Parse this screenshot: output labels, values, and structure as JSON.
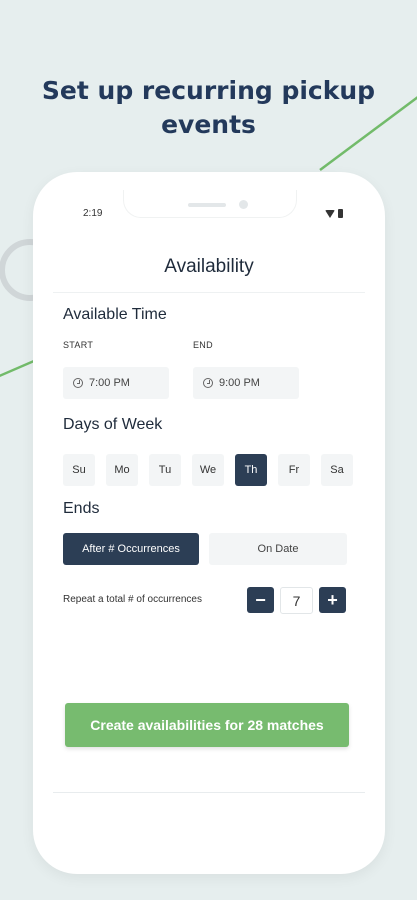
{
  "promo": {
    "headline_line1": "Set up recurring pickup",
    "headline_line2": "events"
  },
  "status_bar": {
    "time": "2:19"
  },
  "screen": {
    "title": "Availability"
  },
  "available_time": {
    "heading": "Available Time",
    "start": {
      "label": "START",
      "value": "7:00 PM"
    },
    "end": {
      "label": "END",
      "value": "9:00 PM"
    }
  },
  "days_of_week": {
    "heading": "Days of Week",
    "days": [
      {
        "label": "Su",
        "selected": false
      },
      {
        "label": "Mo",
        "selected": false
      },
      {
        "label": "Tu",
        "selected": false
      },
      {
        "label": "We",
        "selected": false
      },
      {
        "label": "Th",
        "selected": true
      },
      {
        "label": "Fr",
        "selected": false
      },
      {
        "label": "Sa",
        "selected": false
      }
    ]
  },
  "ends": {
    "heading": "Ends",
    "options": [
      {
        "label": "After # Occurrences",
        "selected": true
      },
      {
        "label": "On Date",
        "selected": false
      }
    ],
    "repeat_label": "Repeat a total # of occurrences",
    "decrement_symbol": "−",
    "count": "7",
    "increment_symbol": "+"
  },
  "cta": {
    "label": "Create availabilities for 28 matches"
  },
  "colors": {
    "primary": "#2c3e55",
    "accent": "#77bb6f",
    "background": "#e6eeee"
  },
  "icons": {
    "clock": "clock-icon",
    "wifi": "wifi-icon",
    "battery": "battery-icon"
  }
}
